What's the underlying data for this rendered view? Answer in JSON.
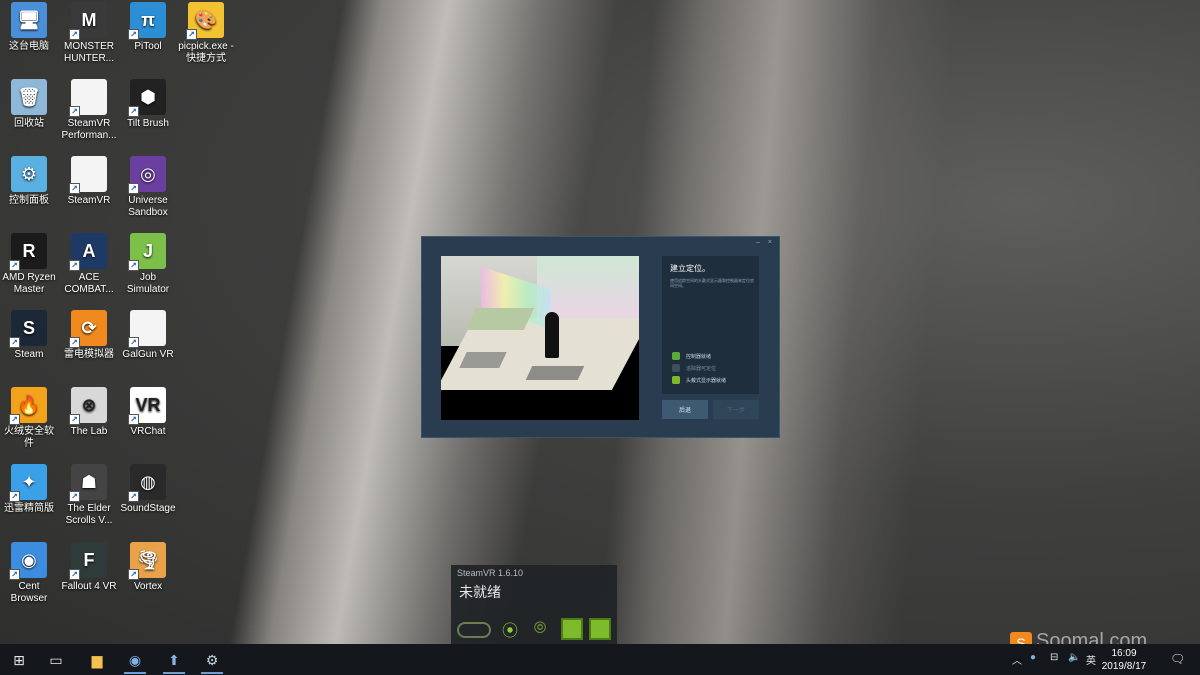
{
  "desktop": {
    "icons": [
      {
        "label": "这台电脑",
        "icon": "this-pc-icon",
        "color": "#4a90d9",
        "glyph": "🖥",
        "shortcut": false
      },
      {
        "label": "MONSTER HUNTER...",
        "icon": "monster-hunter-icon",
        "color": "#3a3a3a",
        "glyph": "M",
        "shortcut": true
      },
      {
        "label": "PiTool",
        "icon": "pitool-icon",
        "color": "#2c8fd6",
        "glyph": "π",
        "shortcut": true
      },
      {
        "label": "picpick.exe - 快捷方式",
        "icon": "picpick-icon",
        "color": "#f2c230",
        "glyph": "🎨",
        "shortcut": true
      },
      {
        "label": "回收站",
        "icon": "recycle-bin-icon",
        "color": "#8fb8d8",
        "glyph": "🗑",
        "shortcut": false
      },
      {
        "label": "SteamVR Performan...",
        "icon": "file-icon",
        "color": "#f4f4f4",
        "glyph": "",
        "shortcut": true
      },
      {
        "label": "Tilt Brush",
        "icon": "tilt-brush-icon",
        "color": "#222",
        "glyph": "⬢",
        "shortcut": true
      },
      {
        "label": "控制面板",
        "icon": "control-panel-icon",
        "color": "#5ab0e0",
        "glyph": "⚙",
        "shortcut": false
      },
      {
        "label": "SteamVR",
        "icon": "file-icon",
        "color": "#f4f4f4",
        "glyph": "",
        "shortcut": true
      },
      {
        "label": "Universe Sandbox",
        "icon": "universe-sandbox-icon",
        "color": "#6a3fa0",
        "glyph": "◎",
        "shortcut": true
      },
      {
        "label": "AMD Ryzen Master",
        "icon": "amd-ryzen-icon",
        "color": "#1b1b1b",
        "glyph": "R",
        "shortcut": true
      },
      {
        "label": "ACE COMBAT...",
        "icon": "ace-combat-icon",
        "color": "#1d3a66",
        "glyph": "A",
        "shortcut": true
      },
      {
        "label": "Job Simulator",
        "icon": "job-simulator-icon",
        "color": "#7cc04a",
        "glyph": "J",
        "shortcut": true
      },
      {
        "label": "Steam",
        "icon": "steam-icon",
        "color": "#1b2838",
        "glyph": "S",
        "shortcut": true
      },
      {
        "label": "雷电模拟器",
        "icon": "ldplayer-icon",
        "color": "#f08a1e",
        "glyph": "⟳",
        "shortcut": true
      },
      {
        "label": "GalGun VR",
        "icon": "file-icon",
        "color": "#f4f4f4",
        "glyph": "",
        "shortcut": true
      },
      {
        "label": "火绒安全软件",
        "icon": "huorong-icon",
        "color": "#f3a21b",
        "glyph": "🔥",
        "shortcut": true
      },
      {
        "label": "The Lab",
        "icon": "the-lab-icon",
        "color": "#d8d8d8",
        "glyph": "⊗",
        "shortcut": true
      },
      {
        "label": "VRChat",
        "icon": "vrchat-icon",
        "color": "#fff",
        "glyph": "VR",
        "shortcut": true
      },
      {
        "label": "迅雷精简版",
        "icon": "xunlei-icon",
        "color": "#3aa0e8",
        "glyph": "✦",
        "shortcut": true
      },
      {
        "label": "The Elder Scrolls V...",
        "icon": "elder-scrolls-icon",
        "color": "#444",
        "glyph": "☗",
        "shortcut": true
      },
      {
        "label": "SoundStage",
        "icon": "soundstage-icon",
        "color": "#2a2a2a",
        "glyph": "◍",
        "shortcut": true
      },
      {
        "label": "Cent Browser",
        "icon": "cent-browser-icon",
        "color": "#3c8de0",
        "glyph": "◉",
        "shortcut": true
      },
      {
        "label": "Fallout 4 VR",
        "icon": "fallout-icon",
        "color": "#2f3b3a",
        "glyph": "F",
        "shortcut": true
      },
      {
        "label": "Vortex",
        "icon": "vortex-icon",
        "color": "#e9a24a",
        "glyph": "🌪",
        "shortcut": true
      }
    ]
  },
  "room_setup": {
    "title": "建立定位。",
    "description": "使用追踪空间的头戴式显示器和控制器来定位房间空间。",
    "steps": [
      {
        "label": "控制器就绪",
        "state": "done",
        "color": "#5aaa3a"
      },
      {
        "label": "追踪器可定位",
        "state": "pending",
        "color": "#5a6a78"
      },
      {
        "label": "头戴式显示器就绪",
        "state": "active",
        "color": "#7dbb2a"
      }
    ],
    "back_label": "后退",
    "next_label": "下一步"
  },
  "steamvr_status": {
    "title": "SteamVR 1.6.10",
    "status": "未就绪",
    "devices": [
      "headset-icon",
      "controller-icon",
      "controller-icon",
      "base-station-icon",
      "base-station-icon"
    ]
  },
  "taskbar": {
    "apps": [
      "start-icon",
      "task-view-icon",
      "file-explorer-icon",
      "steamvr-icon",
      "steamvr-app-icon",
      "steam-icon"
    ],
    "tray_lang": "英",
    "time": "16:09",
    "date": "2019/8/17",
    "accent": "#6aa0d8"
  },
  "watermark": {
    "text": "Soomal.com"
  }
}
